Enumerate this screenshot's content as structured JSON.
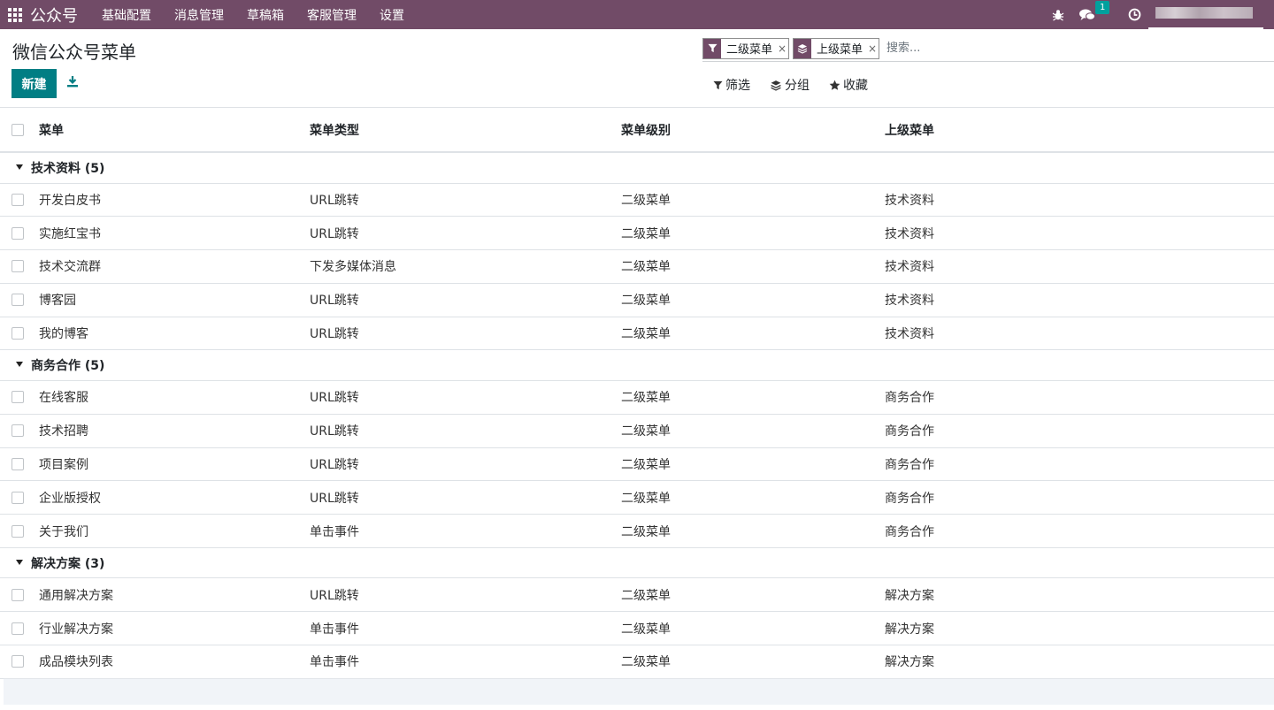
{
  "navbar": {
    "brand": "公众号",
    "menus": [
      "基础配置",
      "消息管理",
      "草稿箱",
      "客服管理",
      "设置"
    ],
    "chat_badge": "1",
    "colors": {
      "bar": "#714B67",
      "badge": "#00A09D"
    }
  },
  "control": {
    "title": "微信公众号菜单",
    "new_label": "新建",
    "facets": [
      {
        "icon": "filter-icon",
        "label": "二级菜单"
      },
      {
        "icon": "layers-icon",
        "label": "上级菜单"
      }
    ],
    "search_placeholder": "搜索...",
    "filter_label": "筛选",
    "group_label": "分组",
    "favorite_label": "收藏"
  },
  "table": {
    "headers": [
      "菜单",
      "菜单类型",
      "菜单级别",
      "上级菜单"
    ],
    "groups": [
      {
        "title": "技术资料 (5)",
        "rows": [
          [
            "开发白皮书",
            "URL跳转",
            "二级菜单",
            "技术资料"
          ],
          [
            "实施红宝书",
            "URL跳转",
            "二级菜单",
            "技术资料"
          ],
          [
            "技术交流群",
            "下发多媒体消息",
            "二级菜单",
            "技术资料"
          ],
          [
            "博客园",
            "URL跳转",
            "二级菜单",
            "技术资料"
          ],
          [
            "我的博客",
            "URL跳转",
            "二级菜单",
            "技术资料"
          ]
        ]
      },
      {
        "title": "商务合作 (5)",
        "rows": [
          [
            "在线客服",
            "URL跳转",
            "二级菜单",
            "商务合作"
          ],
          [
            "技术招聘",
            "URL跳转",
            "二级菜单",
            "商务合作"
          ],
          [
            "项目案例",
            "URL跳转",
            "二级菜单",
            "商务合作"
          ],
          [
            "企业版授权",
            "URL跳转",
            "二级菜单",
            "商务合作"
          ],
          [
            "关于我们",
            "单击事件",
            "二级菜单",
            "商务合作"
          ]
        ]
      },
      {
        "title": "解决方案 (3)",
        "rows": [
          [
            "通用解决方案",
            "URL跳转",
            "二级菜单",
            "解决方案"
          ],
          [
            "行业解决方案",
            "单击事件",
            "二级菜单",
            "解决方案"
          ],
          [
            "成品模块列表",
            "单击事件",
            "二级菜单",
            "解决方案"
          ]
        ]
      }
    ]
  }
}
